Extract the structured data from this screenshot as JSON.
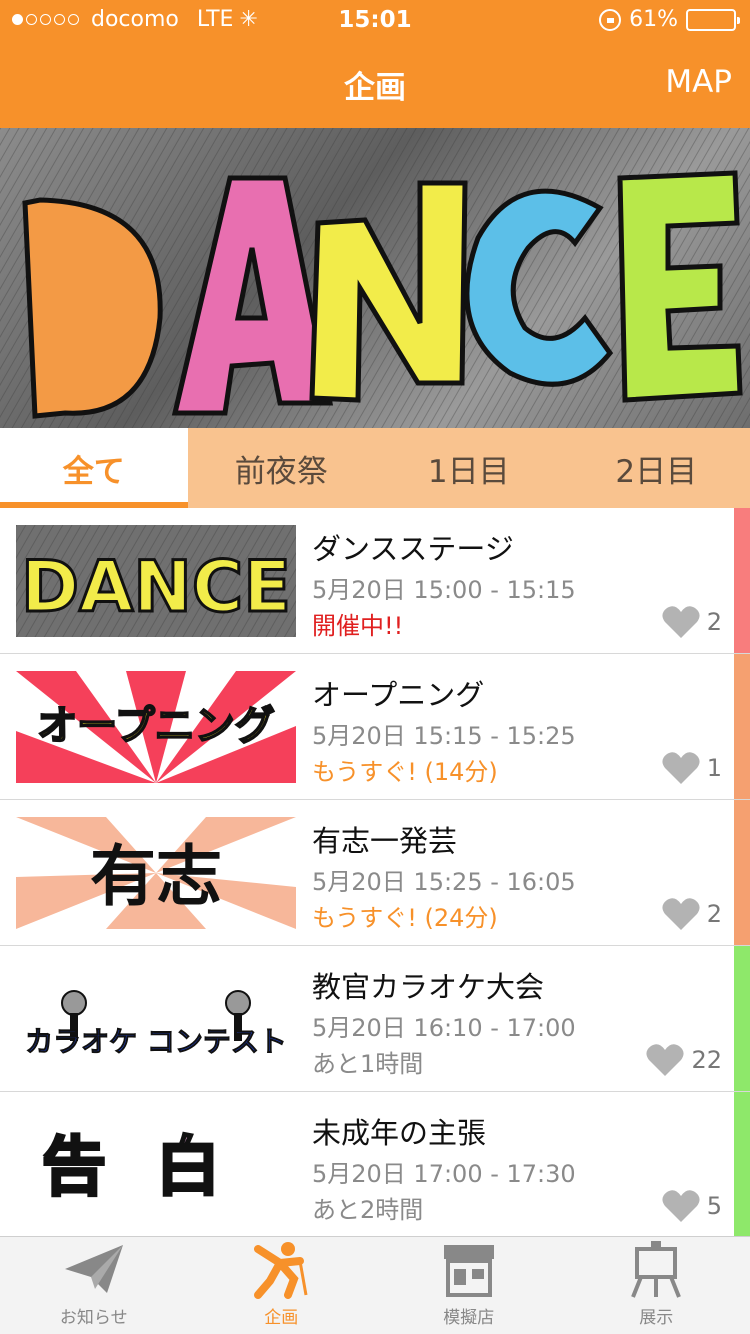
{
  "status_bar": {
    "carrier": "docomo",
    "network": "LTE",
    "time": "15:01",
    "battery": "61%",
    "signal_bars_filled": 1,
    "signal_bars_total": 5,
    "battery_level": 0.61
  },
  "nav": {
    "title": "企画",
    "right_button": "MAP"
  },
  "hero": {
    "image_text": "DANCE"
  },
  "tabs": [
    {
      "label": "全て",
      "active": true
    },
    {
      "label": "前夜祭",
      "active": false
    },
    {
      "label": "1日目",
      "active": false
    },
    {
      "label": "2日目",
      "active": false
    }
  ],
  "events": [
    {
      "title": "ダンスステージ",
      "time": "5月20日  15:00 - 15:15",
      "status": "開催中!!",
      "status_color": "#e02020",
      "likes": "2",
      "bar_color": "#f87d7d",
      "image": "DANCE"
    },
    {
      "title": "オープニング",
      "time": "5月20日  15:15 - 15:25",
      "status": "もうすぐ! (14分)",
      "status_color": "#f7912a",
      "likes": "1",
      "bar_color": "#f5a070",
      "image": "オープニング"
    },
    {
      "title": "有志一発芸",
      "time": "5月20日  15:25 - 16:05",
      "status": "もうすぐ! (24分)",
      "status_color": "#f7912a",
      "likes": "2",
      "bar_color": "#f5a070",
      "image": "有志"
    },
    {
      "title": "教官カラオケ大会",
      "time": "5月20日  16:10 - 17:00",
      "status": "あと1時間",
      "status_color": "#8a8a8a",
      "likes": "22",
      "bar_color": "#8ee86a",
      "image": "カラオケ コンテスト"
    },
    {
      "title": "未成年の主張",
      "time": "5月20日  17:00 - 17:30",
      "status": "あと2時間",
      "status_color": "#8a8a8a",
      "likes": "5",
      "bar_color": "#8ee86a",
      "image": "告白"
    }
  ],
  "tabbar": [
    {
      "label": "お知らせ",
      "icon": "paper-plane-icon",
      "active": false
    },
    {
      "label": "企画",
      "icon": "singer-icon",
      "active": true
    },
    {
      "label": "模擬店",
      "icon": "shop-icon",
      "active": false
    },
    {
      "label": "展示",
      "icon": "easel-icon",
      "active": false
    }
  ],
  "colors": {
    "accent": "#f7912a",
    "tab_bg": "#f9c38f"
  }
}
